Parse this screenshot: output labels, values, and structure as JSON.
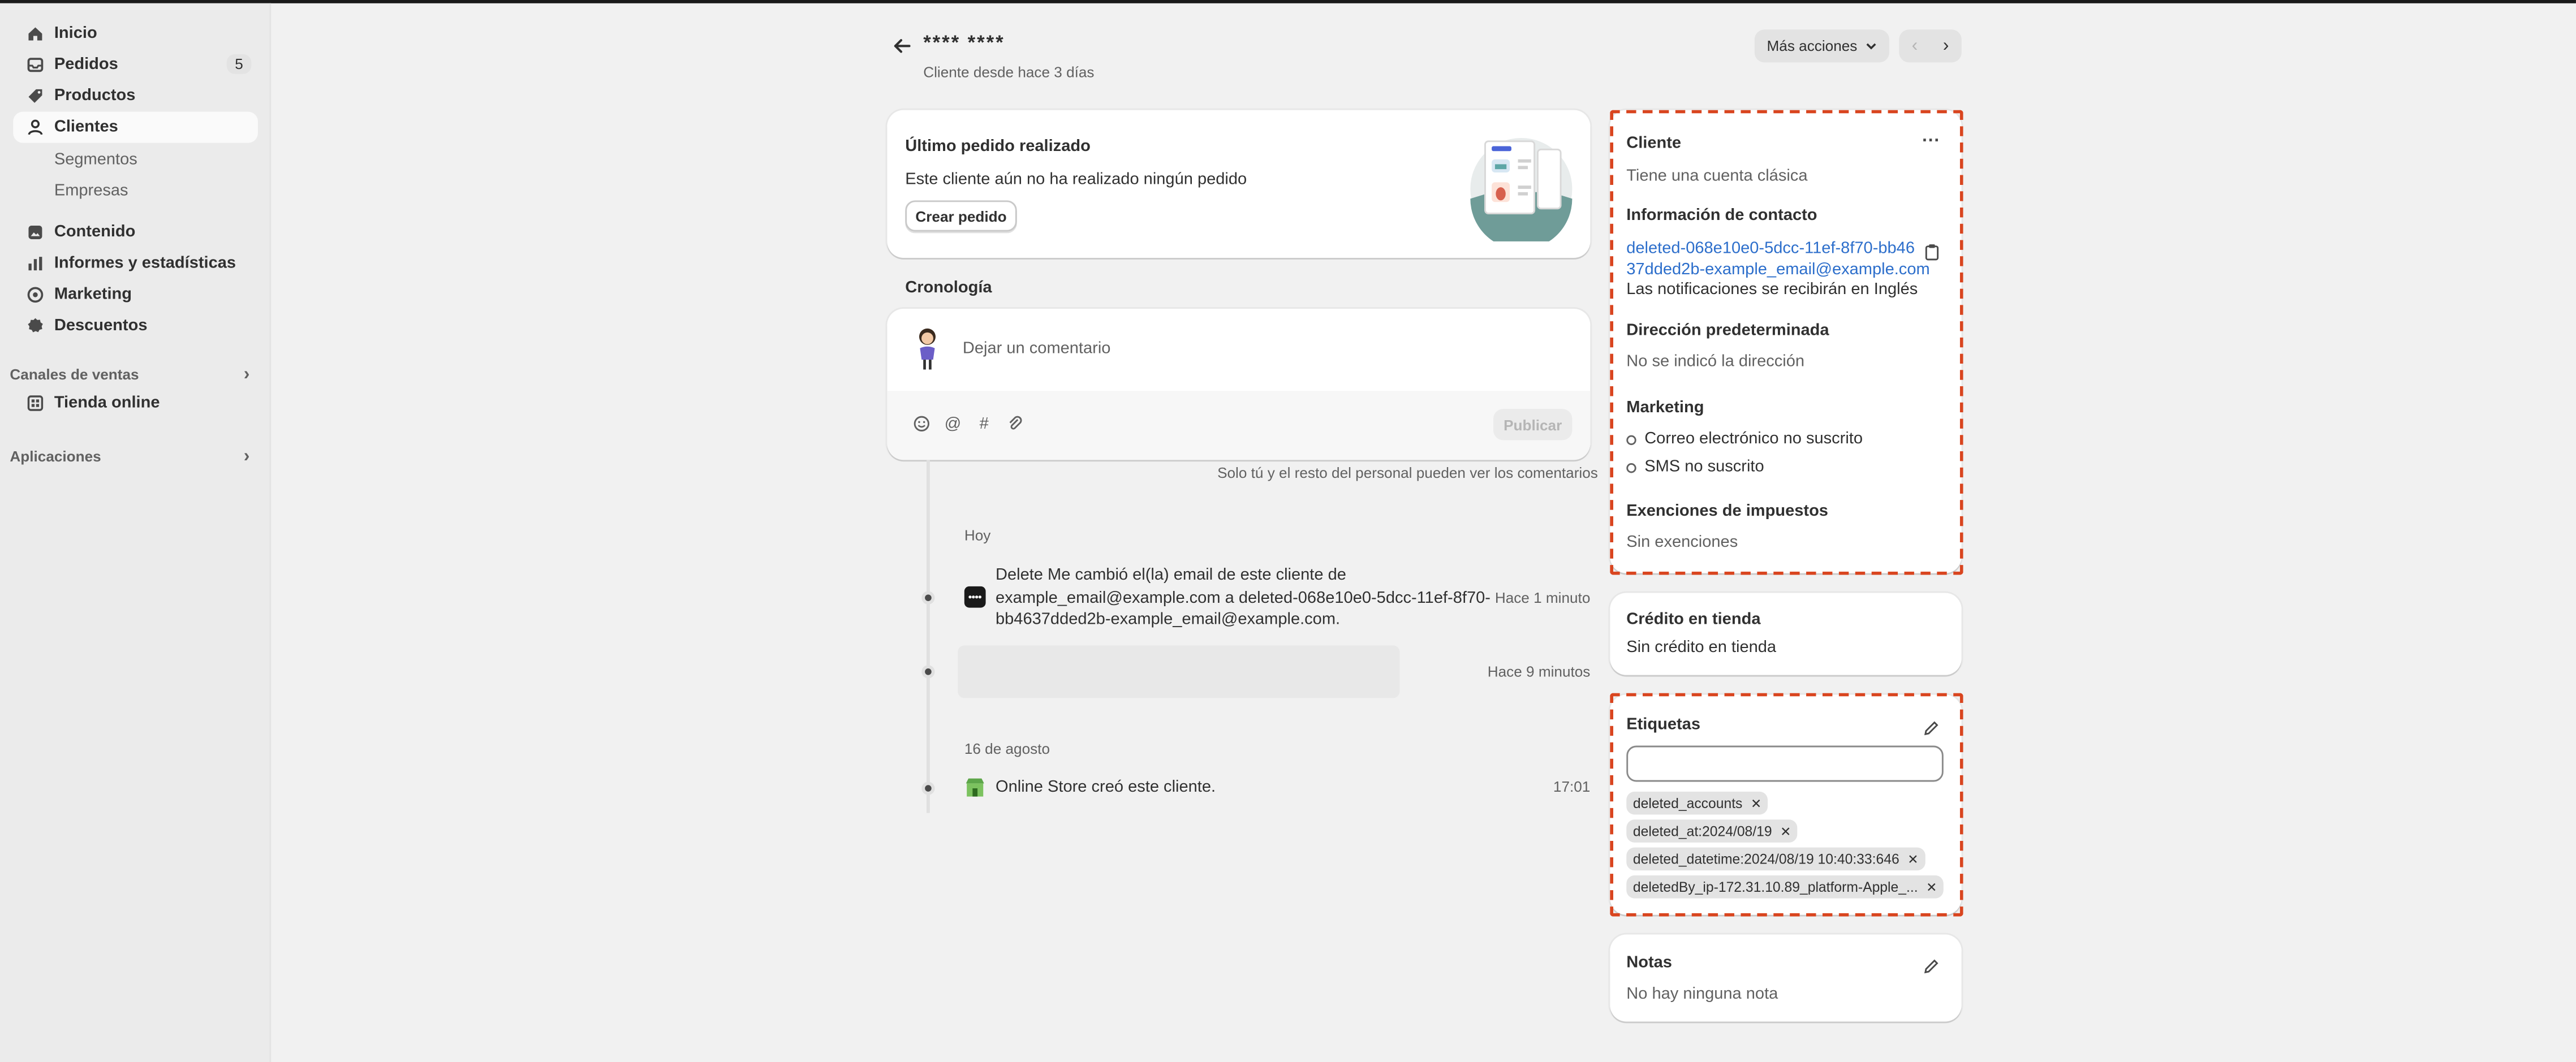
{
  "sidebar": {
    "items": [
      {
        "label": "Inicio",
        "icon": "home-icon"
      },
      {
        "label": "Pedidos",
        "icon": "inbox-icon",
        "badge": "5"
      },
      {
        "label": "Productos",
        "icon": "tag-icon"
      },
      {
        "label": "Clientes",
        "icon": "person-icon",
        "active": true
      },
      {
        "label": "Segmentos"
      },
      {
        "label": "Empresas"
      },
      {
        "label": "Contenido",
        "icon": "content-icon"
      },
      {
        "label": "Informes y estadísticas",
        "icon": "chart-icon"
      },
      {
        "label": "Marketing",
        "icon": "target-icon"
      },
      {
        "label": "Descuentos",
        "icon": "discount-icon"
      }
    ],
    "sales_channels": {
      "label": "Canales de ventas",
      "items": [
        {
          "label": "Tienda online",
          "icon": "store-icon"
        }
      ]
    },
    "apps": {
      "label": "Aplicaciones"
    }
  },
  "header": {
    "title": "**** ****",
    "subtitle": "Cliente desde hace 3 días",
    "more_actions": "Más acciones"
  },
  "last_order": {
    "title": "Último pedido realizado",
    "text": "Este cliente aún no ha realizado ningún pedido",
    "button": "Crear pedido"
  },
  "timeline": {
    "title": "Cronología",
    "placeholder": "Dejar un comentario",
    "publish": "Publicar",
    "note": "Solo tú y el resto del personal pueden ver los comentarios",
    "groups": [
      {
        "date": "Hoy"
      },
      {
        "date": "16 de agosto"
      }
    ],
    "events": [
      {
        "line1": "Delete Me cambió el(la) email de este cliente de",
        "line2": "example_email@example.com a deleted-068e10e0-5dcc-11ef-8f70-",
        "line3": "bb4637dded2b-example_email@example.com.",
        "time": "Hace 1 minuto"
      },
      {
        "time": "Hace 9 minutos"
      },
      {
        "text": "Online Store creó este cliente.",
        "time": "17:01"
      }
    ]
  },
  "customer": {
    "title": "Cliente",
    "account": "Tiene una cuenta clásica",
    "contact_title": "Información de contacto",
    "email_line1": "deleted-068e10e0-5dcc-11ef-8f70-bb46",
    "email_line2": "37dded2b-example_email@example.com",
    "notifications": "Las notificaciones se recibirán en Inglés",
    "address_title": "Dirección predeterminada",
    "address": "No se indicó la dirección",
    "marketing_title": "Marketing",
    "email_marketing": "Correo electrónico no suscrito",
    "sms_marketing": "SMS no suscrito",
    "tax_title": "Exenciones de impuestos",
    "tax": "Sin exenciones"
  },
  "store_credit": {
    "title": "Crédito en tienda",
    "text": "Sin crédito en tienda"
  },
  "tags": {
    "title": "Etiquetas",
    "items": [
      "deleted_accounts",
      "deleted_at:2024/08/19",
      "deleted_datetime:2024/08/19 10:40:33:646",
      "deletedBy_ip-172.31.10.89_platform-Apple_..."
    ]
  },
  "notes": {
    "title": "Notas",
    "text": "No hay ninguna nota"
  },
  "colors": {
    "accent": "#2c6ecb",
    "highlight": "#d9451f"
  }
}
